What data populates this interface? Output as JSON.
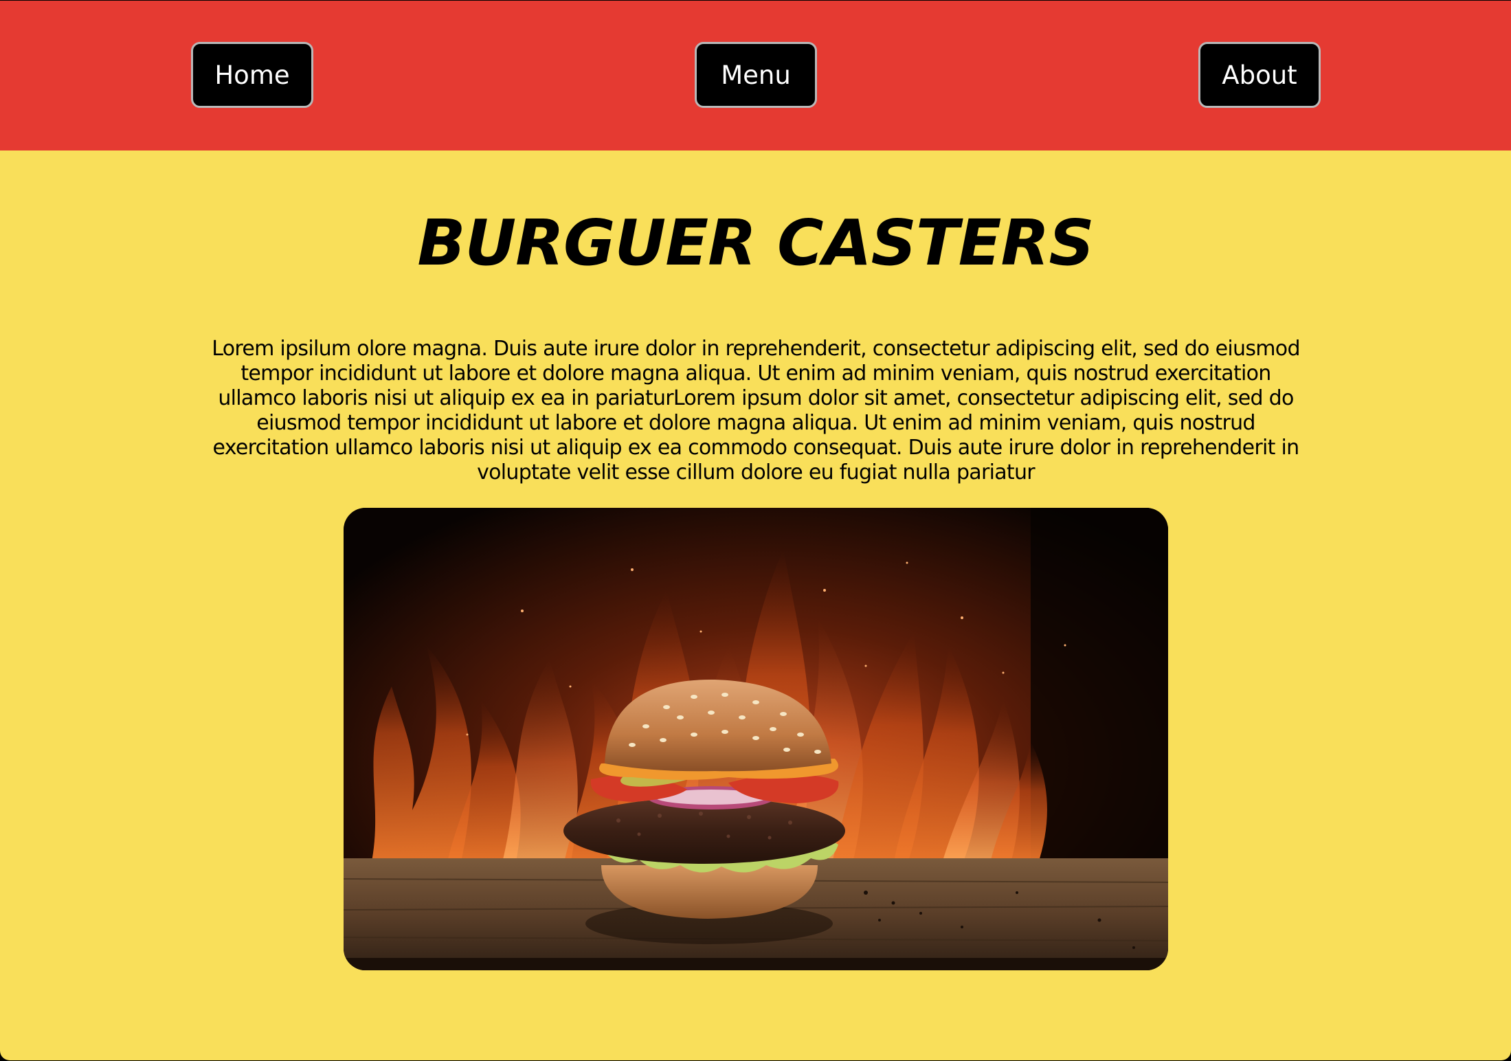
{
  "nav": {
    "home_label": "Home",
    "menu_label": "Menu",
    "about_label": "About"
  },
  "hero_section": {
    "title": "BURGUER CASTERS",
    "description": "Lorem ipsilum olore magna. Duis aute irure dolor in reprehenderit, consectetur adipiscing elit, sed do eiusmod tempor incididunt ut labore et dolore magna aliqua. Ut enim ad minim veniam, quis nostrud exercitation ullamco laboris nisi ut aliquip ex ea in pariaturLorem ipsum dolor sit amet, consectetur adipiscing elit, sed do eiusmod tempor incididunt ut labore et dolore magna aliqua. Ut enim ad minim veniam, quis nostrud exercitation ullamco laboris nisi ut aliquip ex ea commodo consequat. Duis aute irure dolor in reprehenderit in voluptate velit esse cillum dolore eu fugiat nulla pariatur"
  },
  "colors": {
    "navbar_background": "#e53a32",
    "page_background": "#f9df5a",
    "button_background": "#000000",
    "button_text": "#ffffff",
    "button_border": "#b9b9b9"
  },
  "image": {
    "subject": "burger-on-fire-image"
  }
}
